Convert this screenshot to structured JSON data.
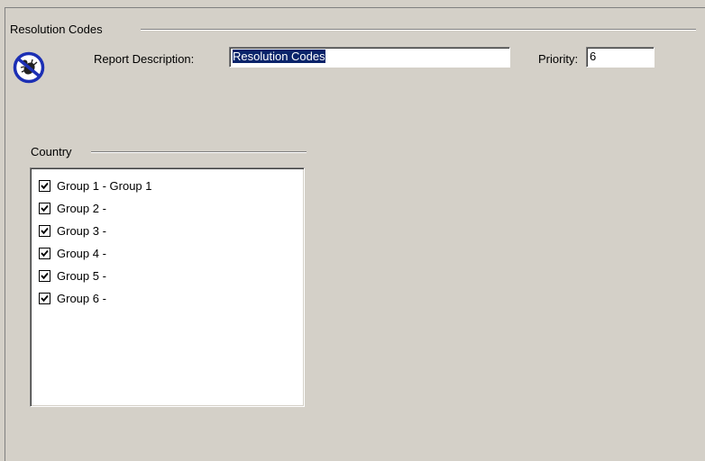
{
  "resolution_group": {
    "title": "Resolution Codes"
  },
  "icon": {
    "name": "no-bug-icon"
  },
  "report_description": {
    "label": "Report Description:",
    "value": "Resolution Codes"
  },
  "priority": {
    "label": "Priority:",
    "value": "6"
  },
  "country_group": {
    "title": "Country",
    "items": [
      {
        "label": "Group 1 - Group 1",
        "checked": true
      },
      {
        "label": "Group 2 -",
        "checked": true
      },
      {
        "label": "Group 3 -",
        "checked": true
      },
      {
        "label": "Group 4 -",
        "checked": true
      },
      {
        "label": "Group 5 -",
        "checked": true
      },
      {
        "label": "Group 6 -",
        "checked": true
      }
    ]
  },
  "colors": {
    "window_bg": "#d4d0c8",
    "selection_bg": "#0a246a",
    "icon_blue": "#1c2fb4"
  }
}
